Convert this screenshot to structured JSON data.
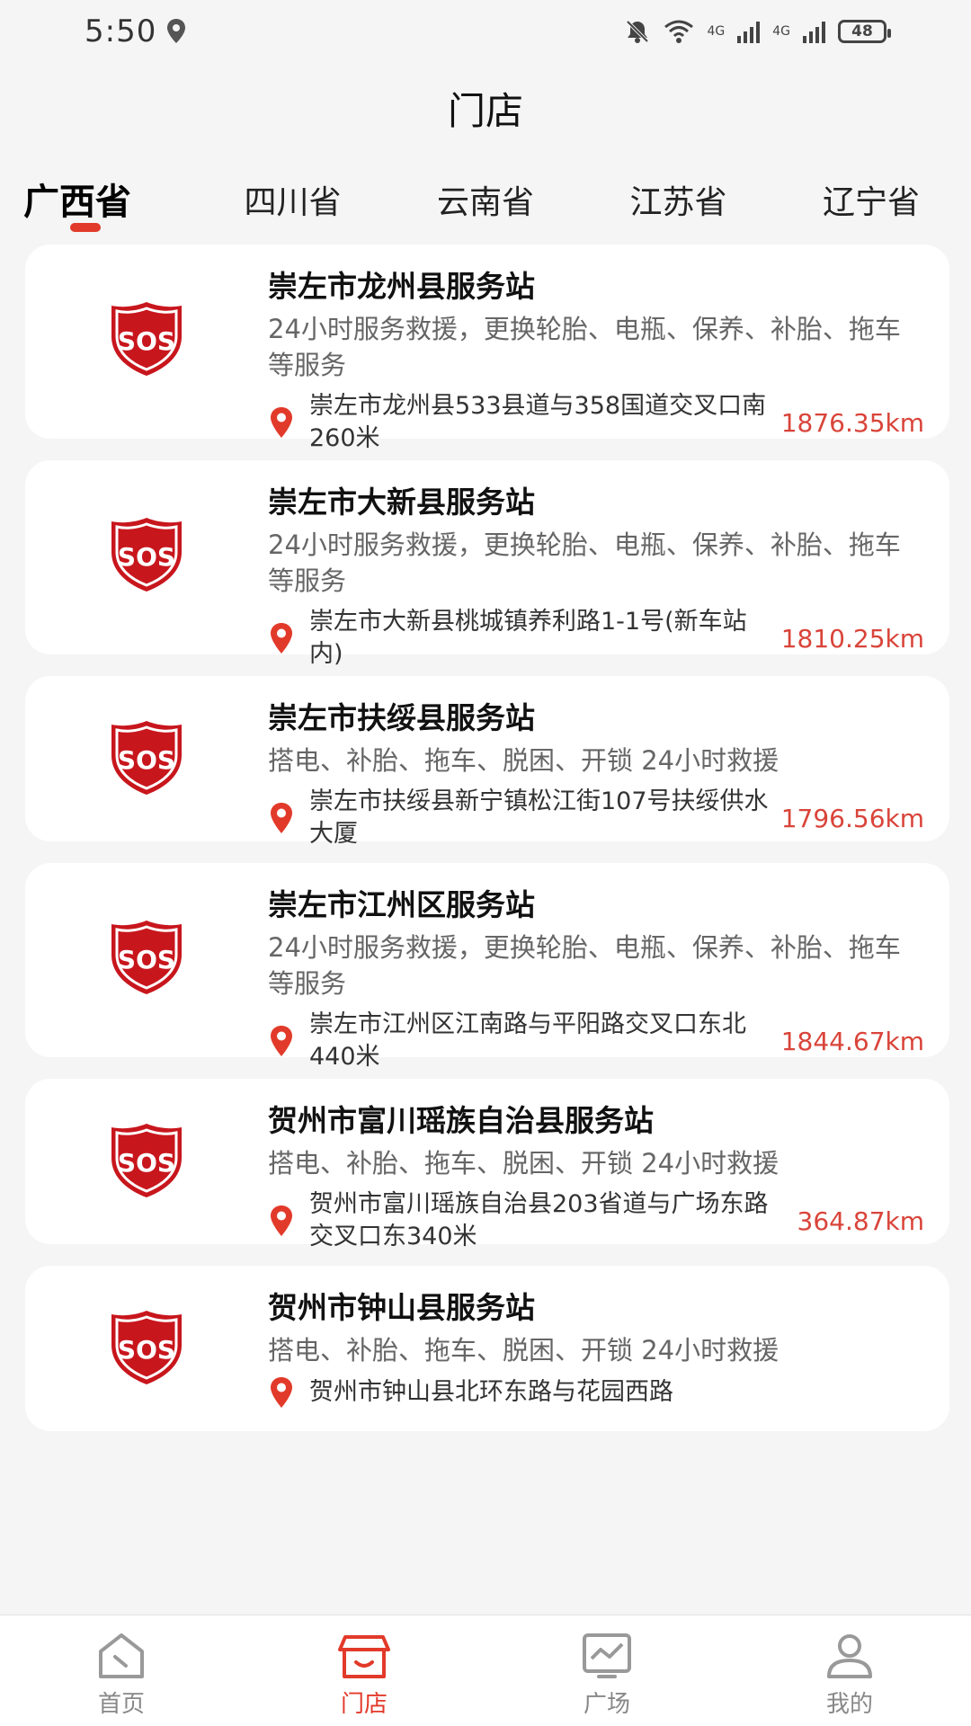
{
  "status_bar": {
    "time": "5:50",
    "network1": "4G",
    "network2": "4G",
    "battery": "48"
  },
  "header": {
    "title": "门店"
  },
  "tabs": [
    {
      "label": "广西省",
      "active": true
    },
    {
      "label": "四川省",
      "active": false
    },
    {
      "label": "云南省",
      "active": false
    },
    {
      "label": "江苏省",
      "active": false
    },
    {
      "label": "辽宁省",
      "active": false
    }
  ],
  "stores": [
    {
      "name": "崇左市龙州县服务站",
      "desc": "24小时服务救援，更换轮胎、电瓶、保养、补胎、拖车等服务",
      "address": "崇左市龙州县533县道与358国道交叉口南260米",
      "distance": "1876.35km"
    },
    {
      "name": "崇左市大新县服务站",
      "desc": "24小时服务救援，更换轮胎、电瓶、保养、补胎、拖车等服务",
      "address": "崇左市大新县桃城镇养利路1-1号(新车站内)",
      "distance": "1810.25km"
    },
    {
      "name": "崇左市扶绥县服务站",
      "desc": "搭电、补胎、拖车、脱困、开锁 24小时救援",
      "address": "崇左市扶绥县新宁镇松江街107号扶绥供水大厦",
      "distance": "1796.56km"
    },
    {
      "name": "崇左市江州区服务站",
      "desc": "24小时服务救援，更换轮胎、电瓶、保养、补胎、拖车等服务",
      "address": "崇左市江州区江南路与平阳路交叉口东北440米",
      "distance": "1844.67km"
    },
    {
      "name": "贺州市富川瑶族自治县服务站",
      "desc": "搭电、补胎、拖车、脱困、开锁 24小时救援",
      "address": "贺州市富川瑶族自治县203省道与广场东路交叉口东340米",
      "distance": "364.87km"
    },
    {
      "name": "贺州市钟山县服务站",
      "desc": "搭电、补胎、拖车、脱困、开锁 24小时救援",
      "address": "贺州市钟山县北环东路与花园西路",
      "distance": ""
    }
  ],
  "nav": [
    {
      "label": "首页",
      "icon": "home-icon",
      "active": false
    },
    {
      "label": "门店",
      "icon": "store-icon",
      "active": true
    },
    {
      "label": "广场",
      "icon": "plaza-icon",
      "active": false
    },
    {
      "label": "我的",
      "icon": "profile-icon",
      "active": false
    }
  ],
  "colors": {
    "accent": "#e23a2a",
    "distance": "#d9443a",
    "sos_red": "#c8161d"
  }
}
